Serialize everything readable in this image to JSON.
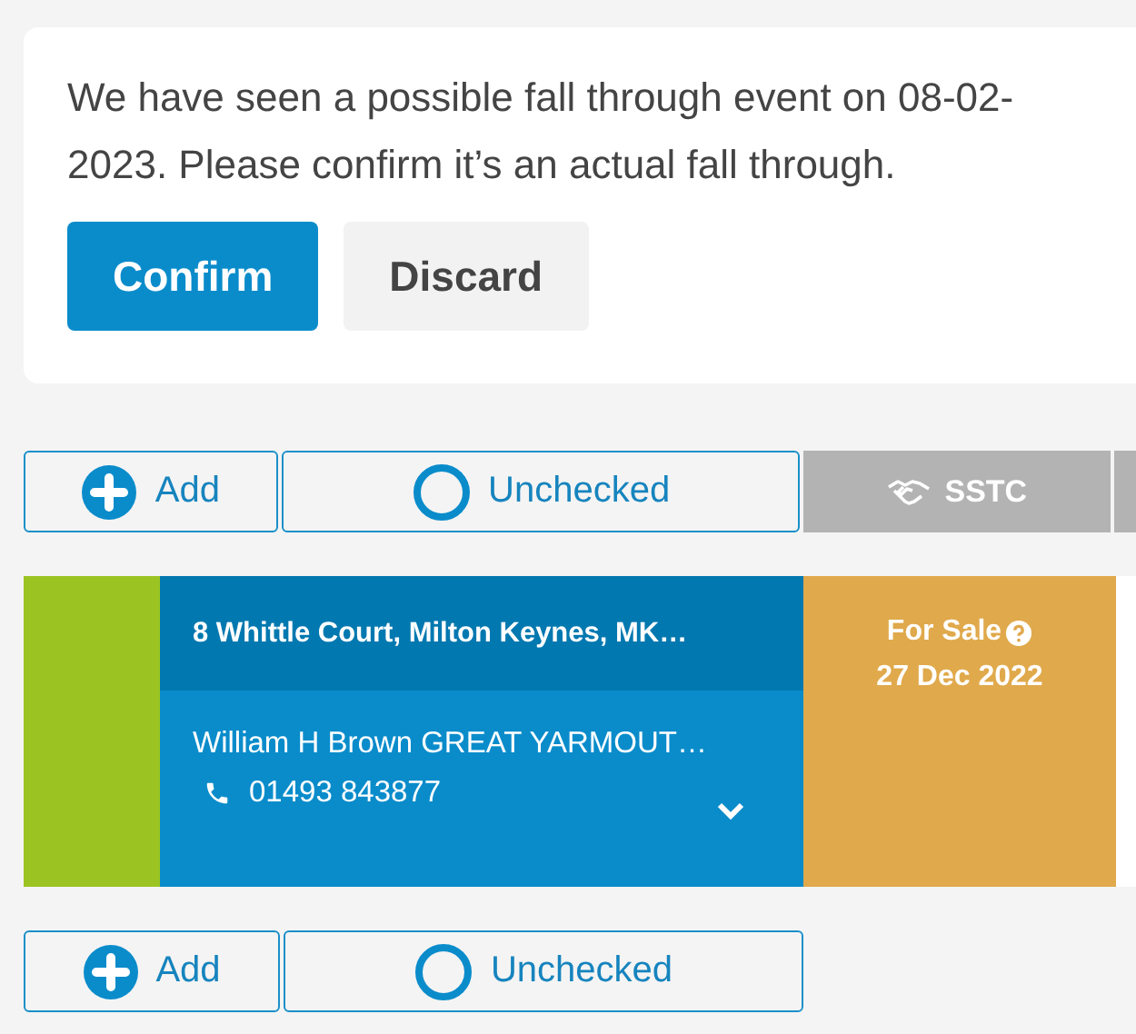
{
  "alert": {
    "message": "We have seen a possible fall through event on 08-02-2023. Please confirm it’s an actual fall through.",
    "buttons": [
      {
        "label": "Confirm",
        "kind": "primary"
      },
      {
        "label": "Discard",
        "kind": "secondary"
      }
    ]
  },
  "rows": [
    {
      "kind": "actions",
      "add_label": "Add",
      "check_label": "Unchecked",
      "checked": false,
      "tags": [
        {
          "label": "SSTC"
        }
      ]
    },
    {
      "kind": "property",
      "address": "8 Whittle Court, Milton Keynes, MK…",
      "agent": "William H Brown GREAT YARMOUT…",
      "phone": "01493 843877",
      "expanded": false,
      "status": "For Sale",
      "date": "27 Dec 2022"
    },
    {
      "kind": "actions",
      "add_label": "Add",
      "check_label": "Unchecked",
      "checked": false,
      "tags": []
    }
  ]
}
